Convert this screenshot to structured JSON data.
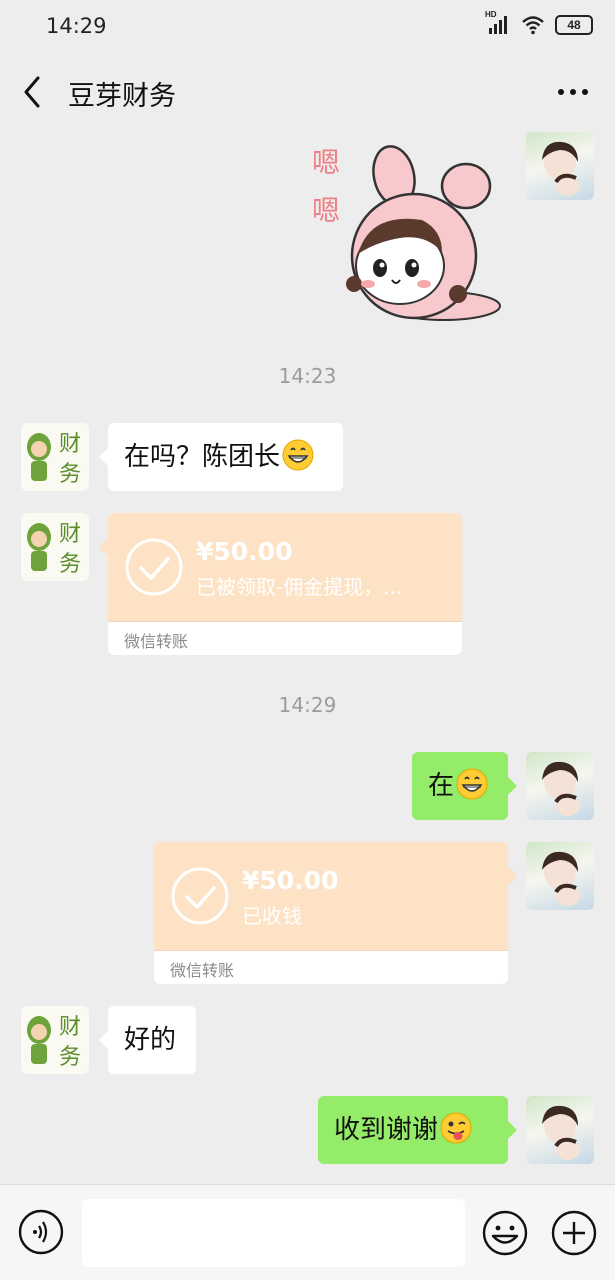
{
  "status_bar": {
    "time": "14:29",
    "network": "HD",
    "battery": "48"
  },
  "navbar": {
    "title": "豆芽财务"
  },
  "sticker": {
    "text": "嗯嗯"
  },
  "avatars": {
    "finance_label": "财务"
  },
  "messages": {
    "time1": "14:23",
    "m1_text": "在吗？陈团长",
    "t1_amount": "¥50.00",
    "t1_desc": "已被领取-佣金提现，...",
    "t1_footer": "微信转账",
    "time2": "14:29",
    "m2_text": "在",
    "t2_amount": "¥50.00",
    "t2_desc": "已收钱",
    "t2_footer": "微信转账",
    "m3_text": "好的",
    "m4_text": "收到谢谢"
  },
  "colors": {
    "outgoing_bubble": "#95ec69",
    "transfer_card": "#fde2c5",
    "background": "#ededed"
  }
}
